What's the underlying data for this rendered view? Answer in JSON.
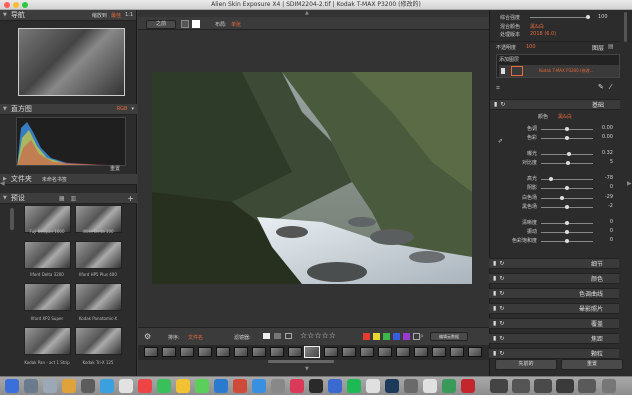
{
  "window": {
    "title": "Alien Skin Exposure X4 | SDIM2204-2.tif | Kodak T-MAX P3200 (修改的)"
  },
  "left": {
    "nav": {
      "title": "导航",
      "fit_label": "缩放到",
      "fit_value": "最佳",
      "ratio": "1:1"
    },
    "histogram": {
      "title": "直方图",
      "mode": "RGB",
      "reset": "重置"
    },
    "folders": {
      "title": "文件夹",
      "status": "未命名书签"
    },
    "presets": {
      "title": "预设",
      "items": [
        {
          "label": "Fuji Neopan 1600"
        },
        {
          "label": "Ilford Delta 100"
        },
        {
          "label": "Ilford Delta 3200"
        },
        {
          "label": "Ilford HP5 Plus 400"
        },
        {
          "label": "Ilford XP2 Super"
        },
        {
          "label": "Kodak Panatomic-X"
        },
        {
          "label": "Kodak Pan - act 1 Strip"
        },
        {
          "label": "Kodak Tri-X 125"
        }
      ]
    }
  },
  "toolbar": {
    "compare": "之前",
    "layout_label": "布局:",
    "layout_value": "单张"
  },
  "bottombar": {
    "sort_label": "排序:",
    "sort_value": "文件名",
    "filter_label": "滤镜器:",
    "stars": "☆☆☆☆☆",
    "right_btn": "编辑云数据"
  },
  "right": {
    "top": {
      "overall_label": "综合强度",
      "overall_value": "100",
      "color_label": "混合颜色",
      "color_value": "黑&白",
      "version_label": "处理版本",
      "version_value": "2018 (6.0)",
      "opacity_label": "不透明度",
      "opacity_value": "100",
      "layers_label": "图层",
      "add_layer": "添加图层",
      "layer_name": "Kodak T-MAX P3200 (修改..."
    },
    "basic": {
      "title": "基础",
      "mode_a": "颜色",
      "mode_b": "黑&白",
      "rows": [
        {
          "label": "色调",
          "value": "0.00"
        },
        {
          "label": "色彩",
          "value": "0.00"
        },
        {
          "label": "曝光",
          "value": "0.32"
        },
        {
          "label": "对比度",
          "value": "5"
        },
        {
          "label": "高光",
          "value": "-78"
        },
        {
          "label": "阴影",
          "value": "0"
        },
        {
          "label": "白色场",
          "value": "-29"
        },
        {
          "label": "黑色场",
          "value": "-2"
        },
        {
          "label": "清晰度",
          "value": "0"
        },
        {
          "label": "振动",
          "value": "0"
        },
        {
          "label": "色彩饱和度",
          "value": "0"
        }
      ]
    },
    "sections": [
      "细节",
      "颜色",
      "色调曲线",
      "晕影照片",
      "覆盖",
      "焦距",
      "颗粒"
    ],
    "buttons": {
      "previous": "先前的",
      "reset": "重置"
    }
  },
  "colors": {
    "accent": "#e86a3c",
    "panel": "#2c2c2c"
  }
}
